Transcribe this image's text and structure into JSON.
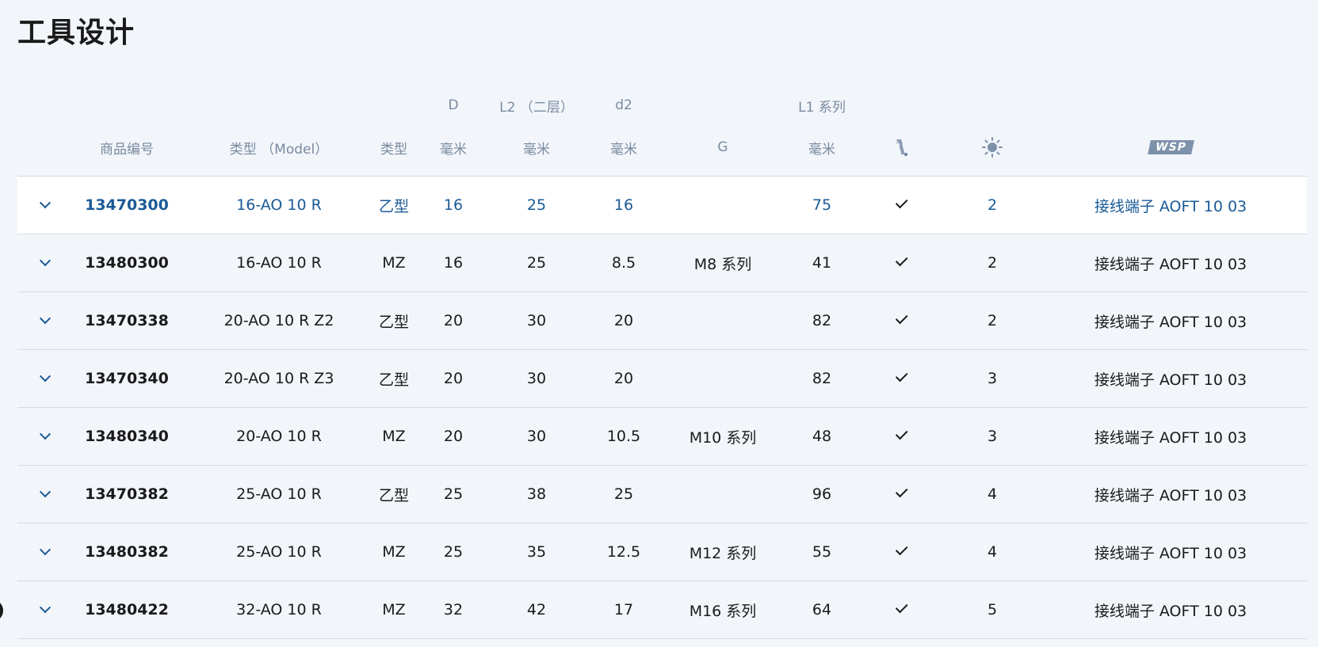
{
  "page_title": "工具设计",
  "header_top": {
    "D": "D",
    "L2": "L2 （二层）",
    "d2": "d2",
    "L1": "L1 系列"
  },
  "header_bottom": {
    "item_no": "商品编号",
    "model": "类型 （Model）",
    "type": "类型",
    "D_unit": "毫米",
    "L2_unit": "毫米",
    "d2_unit": "毫米",
    "G": "G",
    "L1_unit": "毫米",
    "coolant_icon": "coolant-tool-icon",
    "teeth_icon": "sun-icon",
    "wsp_label": "WSP"
  },
  "rows": [
    {
      "item": "13470300",
      "model": "16-AO 10 R",
      "type": "乙型",
      "D": "16",
      "L2": "25",
      "d2": "16",
      "G": "",
      "L1": "75",
      "z": "2",
      "insert": "接线端子 AOFT 10 03",
      "selected": true
    },
    {
      "item": "13480300",
      "model": "16-AO 10 R",
      "type": "MZ",
      "D": "16",
      "L2": "25",
      "d2": "8.5",
      "G": "M8 系列",
      "L1": "41",
      "z": "2",
      "insert": "接线端子 AOFT 10 03",
      "selected": false
    },
    {
      "item": "13470338",
      "model": "20-AO 10 R Z2",
      "type": "乙型",
      "D": "20",
      "L2": "30",
      "d2": "20",
      "G": "",
      "L1": "82",
      "z": "2",
      "insert": "接线端子 AOFT 10 03",
      "selected": false
    },
    {
      "item": "13470340",
      "model": "20-AO 10 R Z3",
      "type": "乙型",
      "D": "20",
      "L2": "30",
      "d2": "20",
      "G": "",
      "L1": "82",
      "z": "3",
      "insert": "接线端子 AOFT 10 03",
      "selected": false
    },
    {
      "item": "13480340",
      "model": "20-AO 10 R",
      "type": "MZ",
      "D": "20",
      "L2": "30",
      "d2": "10.5",
      "G": "M10 系列",
      "L1": "48",
      "z": "3",
      "insert": "接线端子 AOFT 10 03",
      "selected": false
    },
    {
      "item": "13470382",
      "model": "25-AO 10 R",
      "type": "乙型",
      "D": "25",
      "L2": "38",
      "d2": "25",
      "G": "",
      "L1": "96",
      "z": "4",
      "insert": "接线端子 AOFT 10 03",
      "selected": false
    },
    {
      "item": "13480382",
      "model": "25-AO 10 R",
      "type": "MZ",
      "D": "25",
      "L2": "35",
      "d2": "12.5",
      "G": "M12 系列",
      "L1": "55",
      "z": "4",
      "insert": "接线端子 AOFT 10 03",
      "selected": false
    },
    {
      "item": "13480422",
      "model": "32-AO 10 R",
      "type": "MZ",
      "D": "32",
      "L2": "42",
      "d2": "17",
      "G": "M16 系列",
      "L1": "64",
      "z": "5",
      "insert": "接线端子 AOFT 10 03",
      "selected": false
    }
  ],
  "colors": {
    "background": "#f2f5fa",
    "selected_row_bg": "#ffffff",
    "accent_blue": "#1a5a96",
    "header_gray": "#7a8aa0",
    "divider": "#d6dce5"
  }
}
